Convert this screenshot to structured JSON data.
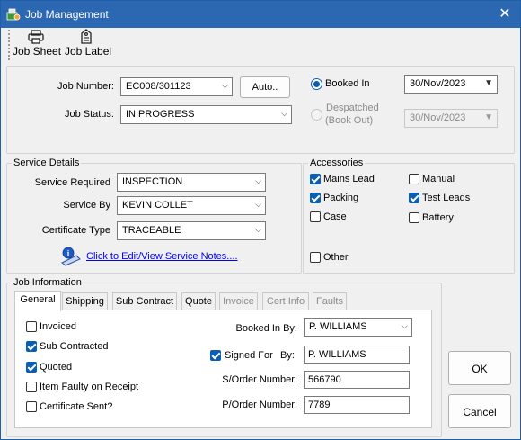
{
  "window": {
    "title": "Job Management",
    "close_glyph": "✕"
  },
  "toolbar": {
    "job_sheet": "Job Sheet",
    "job_label": "Job Label"
  },
  "job": {
    "number_label": "Job Number:",
    "number_value": "EC008/301123",
    "auto_button": "Auto..",
    "status_label": "Job Status:",
    "status_value": "IN PROGRESS",
    "booked_in_label": "Booked In",
    "booked_in_date": "30/Nov/2023",
    "despatched_label_1": "Despatched",
    "despatched_label_2": "(Book Out)",
    "despatched_date": "30/Nov/2023"
  },
  "service": {
    "legend": "Service Details",
    "required_label": "Service Required",
    "required_value": "INSPECTION",
    "by_label": "Service By",
    "by_value": "KEVIN COLLET",
    "cert_label": "Certificate Type",
    "cert_value": "TRACEABLE",
    "notes_link": "Click to Edit/View Service Notes...."
  },
  "accessories": {
    "legend": "Accessories",
    "mains_lead": "Mains Lead",
    "manual": "Manual",
    "packing": "Packing",
    "test_leads": "Test Leads",
    "case": "Case",
    "battery": "Battery",
    "other": "Other"
  },
  "job_info": {
    "legend": "Job Information",
    "tabs": {
      "general": "General",
      "shipping": "Shipping",
      "sub_contract": "Sub Contract",
      "quote": "Quote",
      "invoice": "Invoice",
      "cert_info": "Cert Info",
      "faults": "Faults"
    },
    "invoiced": "Invoiced",
    "sub_contracted": "Sub Contracted",
    "quoted": "Quoted",
    "item_faulty": "Item Faulty on Receipt",
    "certificate_sent": "Certificate Sent?",
    "booked_in_by_label": "Booked In By:",
    "booked_in_by_value": "P. WILLIAMS",
    "signed_for_label": "Signed For",
    "by_label": "By:",
    "signed_for_value": "P. WILLIAMS",
    "sorder_label": "S/Order Number:",
    "sorder_value": "566790",
    "porder_label": "P/Order Number:",
    "porder_value": "7789"
  },
  "buttons": {
    "ok": "OK",
    "cancel": "Cancel"
  },
  "colors": {
    "titlebar": "#2c68b1",
    "accent": "#0a5fb4",
    "link": "#0000ee"
  }
}
